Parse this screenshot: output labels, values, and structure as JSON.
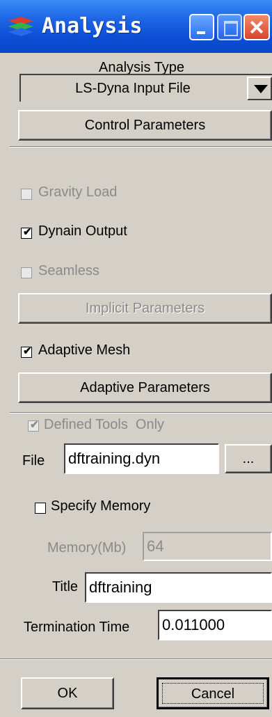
{
  "window": {
    "title": "Analysis",
    "controls": [
      "minimize",
      "maximize",
      "close"
    ]
  },
  "analysis_type": {
    "label": "Analysis Type",
    "selected": "LS-Dyna Input File"
  },
  "buttons": {
    "control_parameters": "Control Parameters",
    "implicit_parameters": "Implicit Parameters",
    "adaptive_parameters": "Adaptive Parameters",
    "browse": "...",
    "ok": "OK",
    "cancel": "Cancel"
  },
  "checkboxes": {
    "gravity_load": {
      "label": "Gravity Load",
      "checked": false,
      "enabled": false
    },
    "dynain_output": {
      "label": "Dynain Output",
      "checked": true,
      "enabled": true
    },
    "seamless": {
      "label": "Seamless",
      "checked": false,
      "enabled": false
    },
    "adaptive_mesh": {
      "label": "Adaptive Mesh",
      "checked": true,
      "enabled": true
    },
    "defined_tools_only": {
      "label": "Defined Tools  Only",
      "checked": true,
      "enabled": false
    },
    "specify_memory": {
      "label": "Specify Memory",
      "checked": false,
      "enabled": true
    }
  },
  "fields": {
    "file": {
      "label": "File",
      "value": "dftraining.dyn"
    },
    "memory": {
      "label": "Memory(Mb)",
      "value": "64"
    },
    "title": {
      "label": "Title",
      "value": "dftraining"
    },
    "termination_time": {
      "label": "Termination Time",
      "value": "0.011000"
    }
  },
  "colors": {
    "titlebar": "#0b4fd6",
    "panel": "#d4d0c8",
    "disabled_text": "#8a8a8a"
  }
}
